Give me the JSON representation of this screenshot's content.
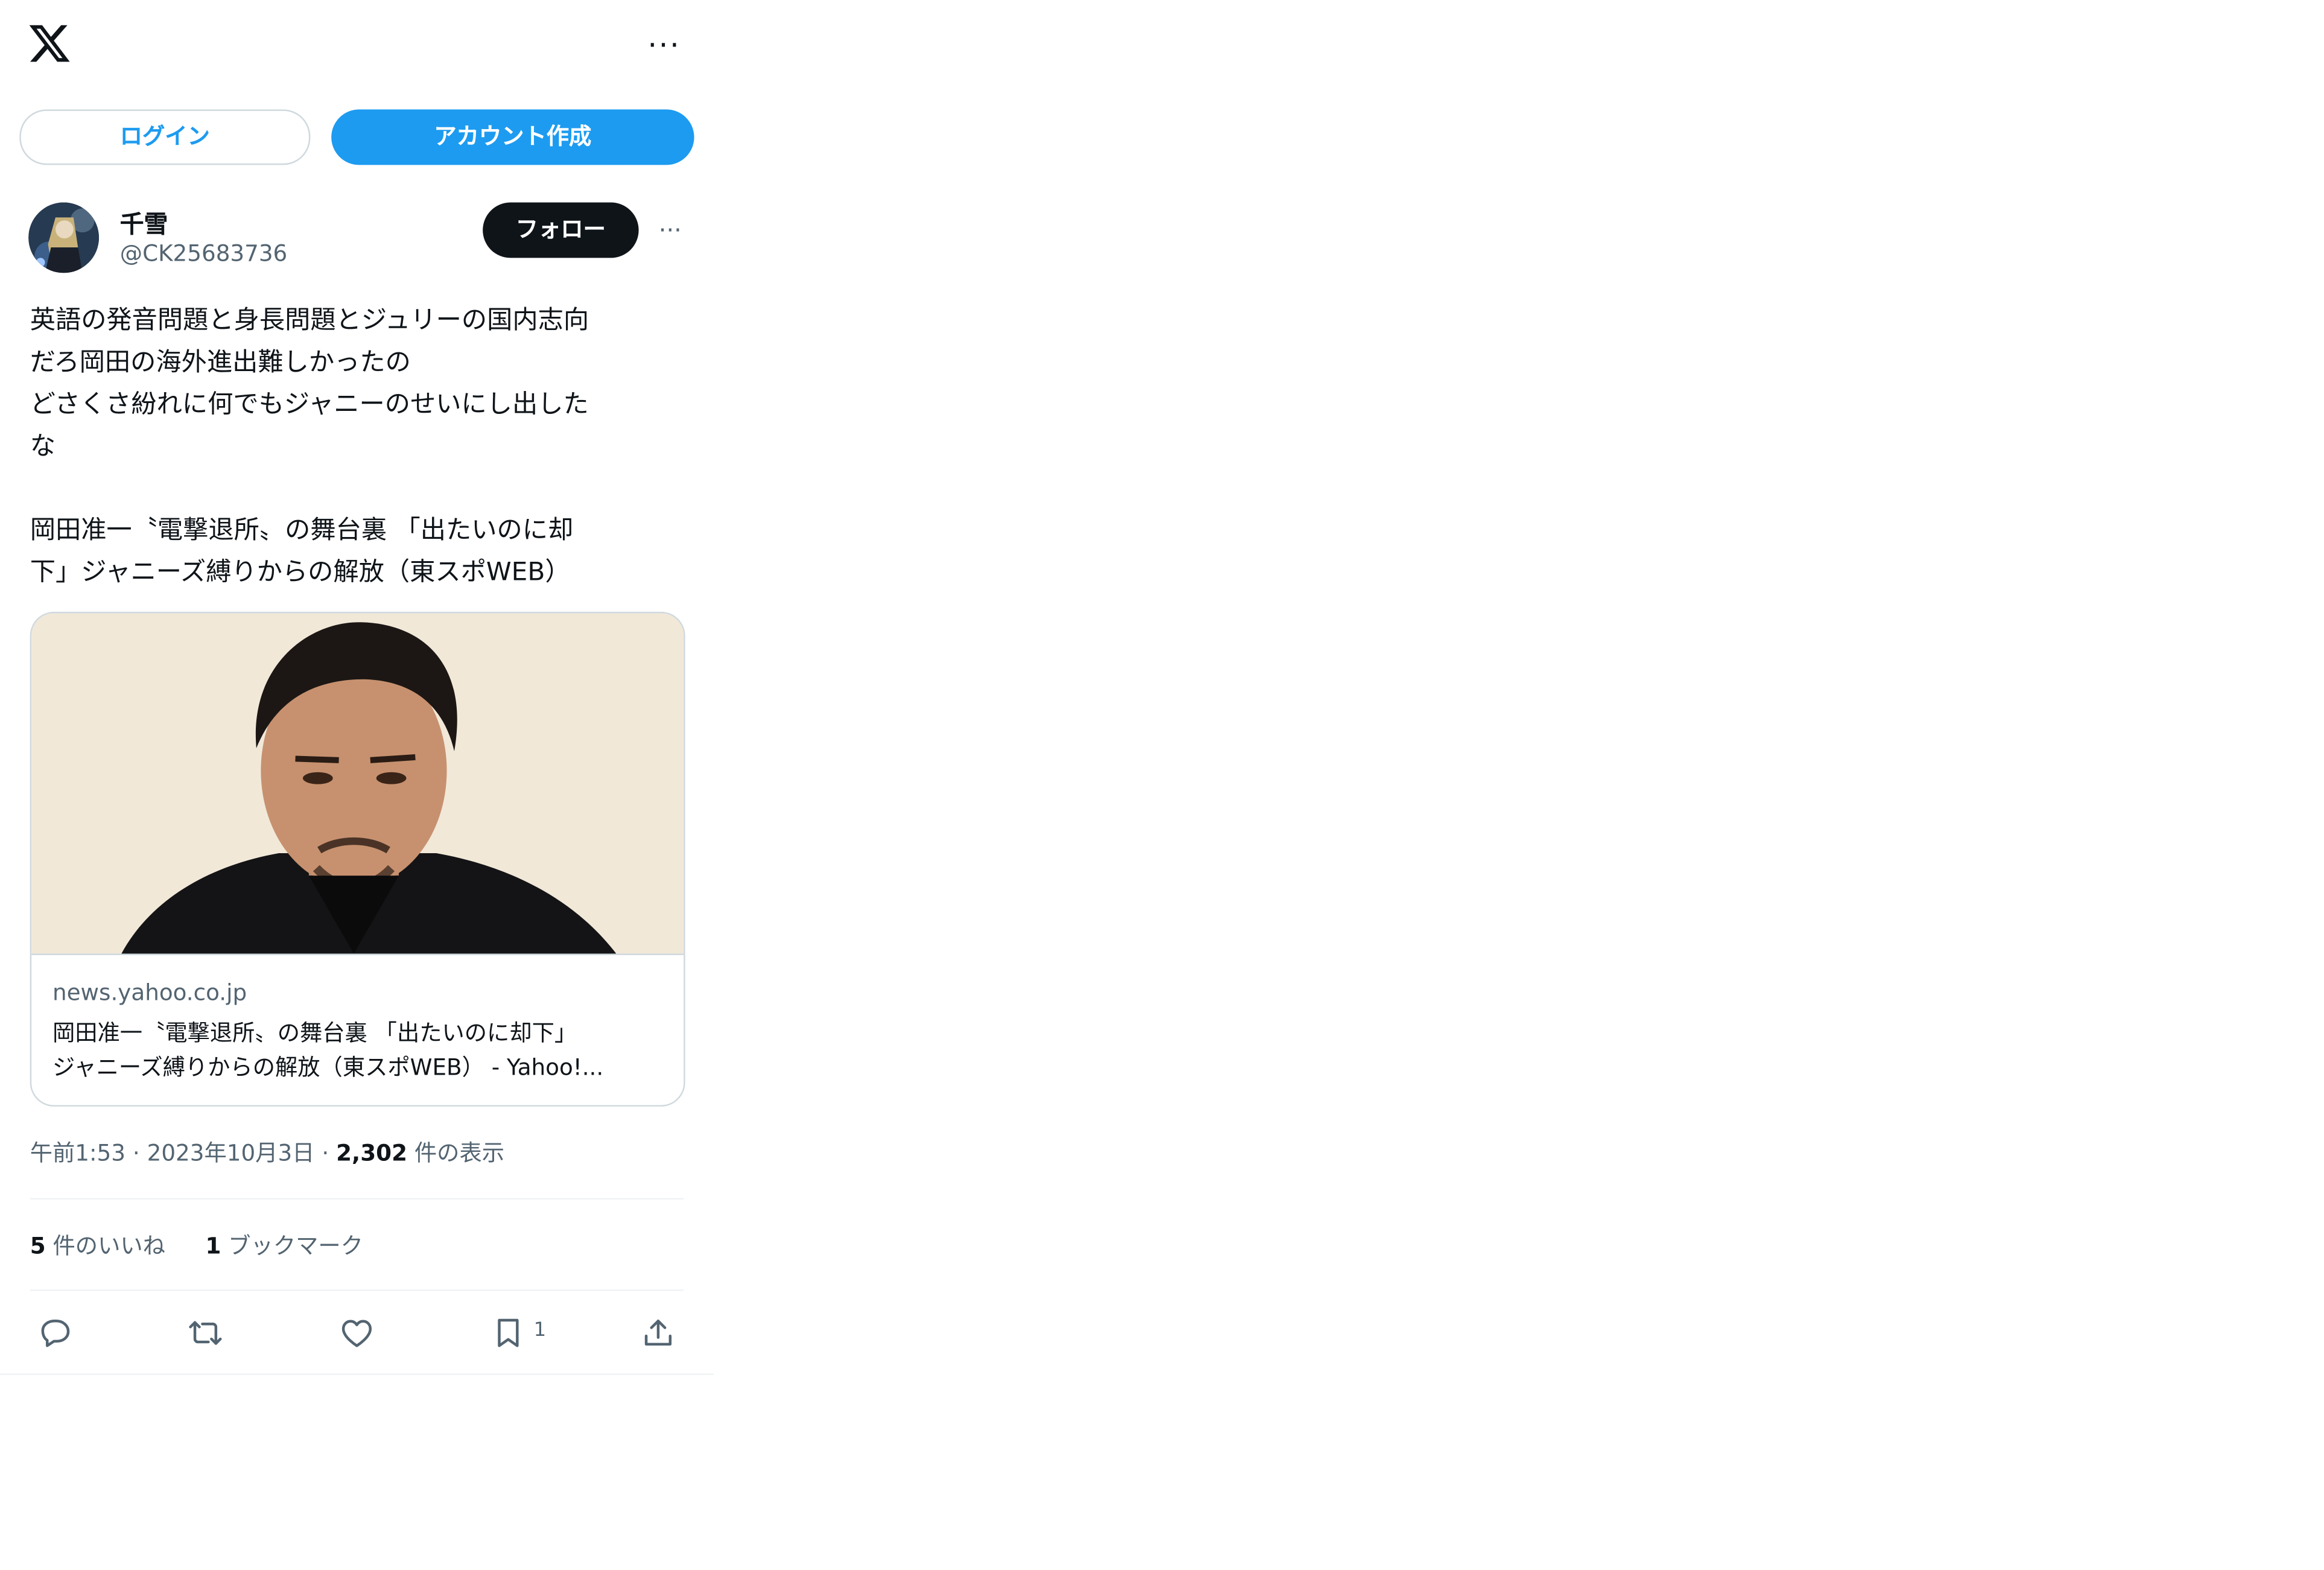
{
  "header": {
    "logo_icon": "x-logo-icon",
    "more_icon": "more-horizontal-icon",
    "more_glyph": "···"
  },
  "auth": {
    "login_label": "ログイン",
    "signup_label": "アカウント作成"
  },
  "tweet": {
    "author_name": "千雪",
    "author_handle": "@CK25683736",
    "follow_label": "フォロー",
    "more_glyph": "···",
    "text_lines": [
      "英語の発音問題と身長問題とジュリーの国内志向",
      "だろ岡田の海外進出難しかったの",
      "どさくさ紛れに何でもジャニーのせいにし出した",
      "な",
      "",
      "岡田准一〝電撃退所〟の舞台裏 「出たいのに却",
      "下」ジャニーズ縛りからの解放（東スポWEB）"
    ],
    "card": {
      "domain": "news.yahoo.co.jp",
      "title_line1": "岡田准一〝電撃退所〟の舞台裏 「出たいのに却下」",
      "title_line2": "ジャニーズ縛りからの解放（東スポWEB） - Yahoo!..."
    },
    "time": "午前1:53",
    "separator": "·",
    "date": "2023年10月3日",
    "views_count": "2,302",
    "views_label": "件の表示",
    "likes_count": "5",
    "likes_label": "件のいいね",
    "bookmarks_count": "1",
    "bookmarks_label": "ブックマーク"
  },
  "actions": {
    "reply_icon": "reply-icon",
    "retweet_icon": "retweet-icon",
    "like_icon": "heart-icon",
    "bookmark_icon": "bookmark-icon",
    "bookmark_count": "1",
    "share_icon": "share-icon"
  },
  "colors": {
    "accent": "#1d9bf0",
    "text_primary": "#0f1419",
    "text_secondary": "#536471",
    "border": "#cfd9de",
    "follow_bg": "#0f1419"
  }
}
